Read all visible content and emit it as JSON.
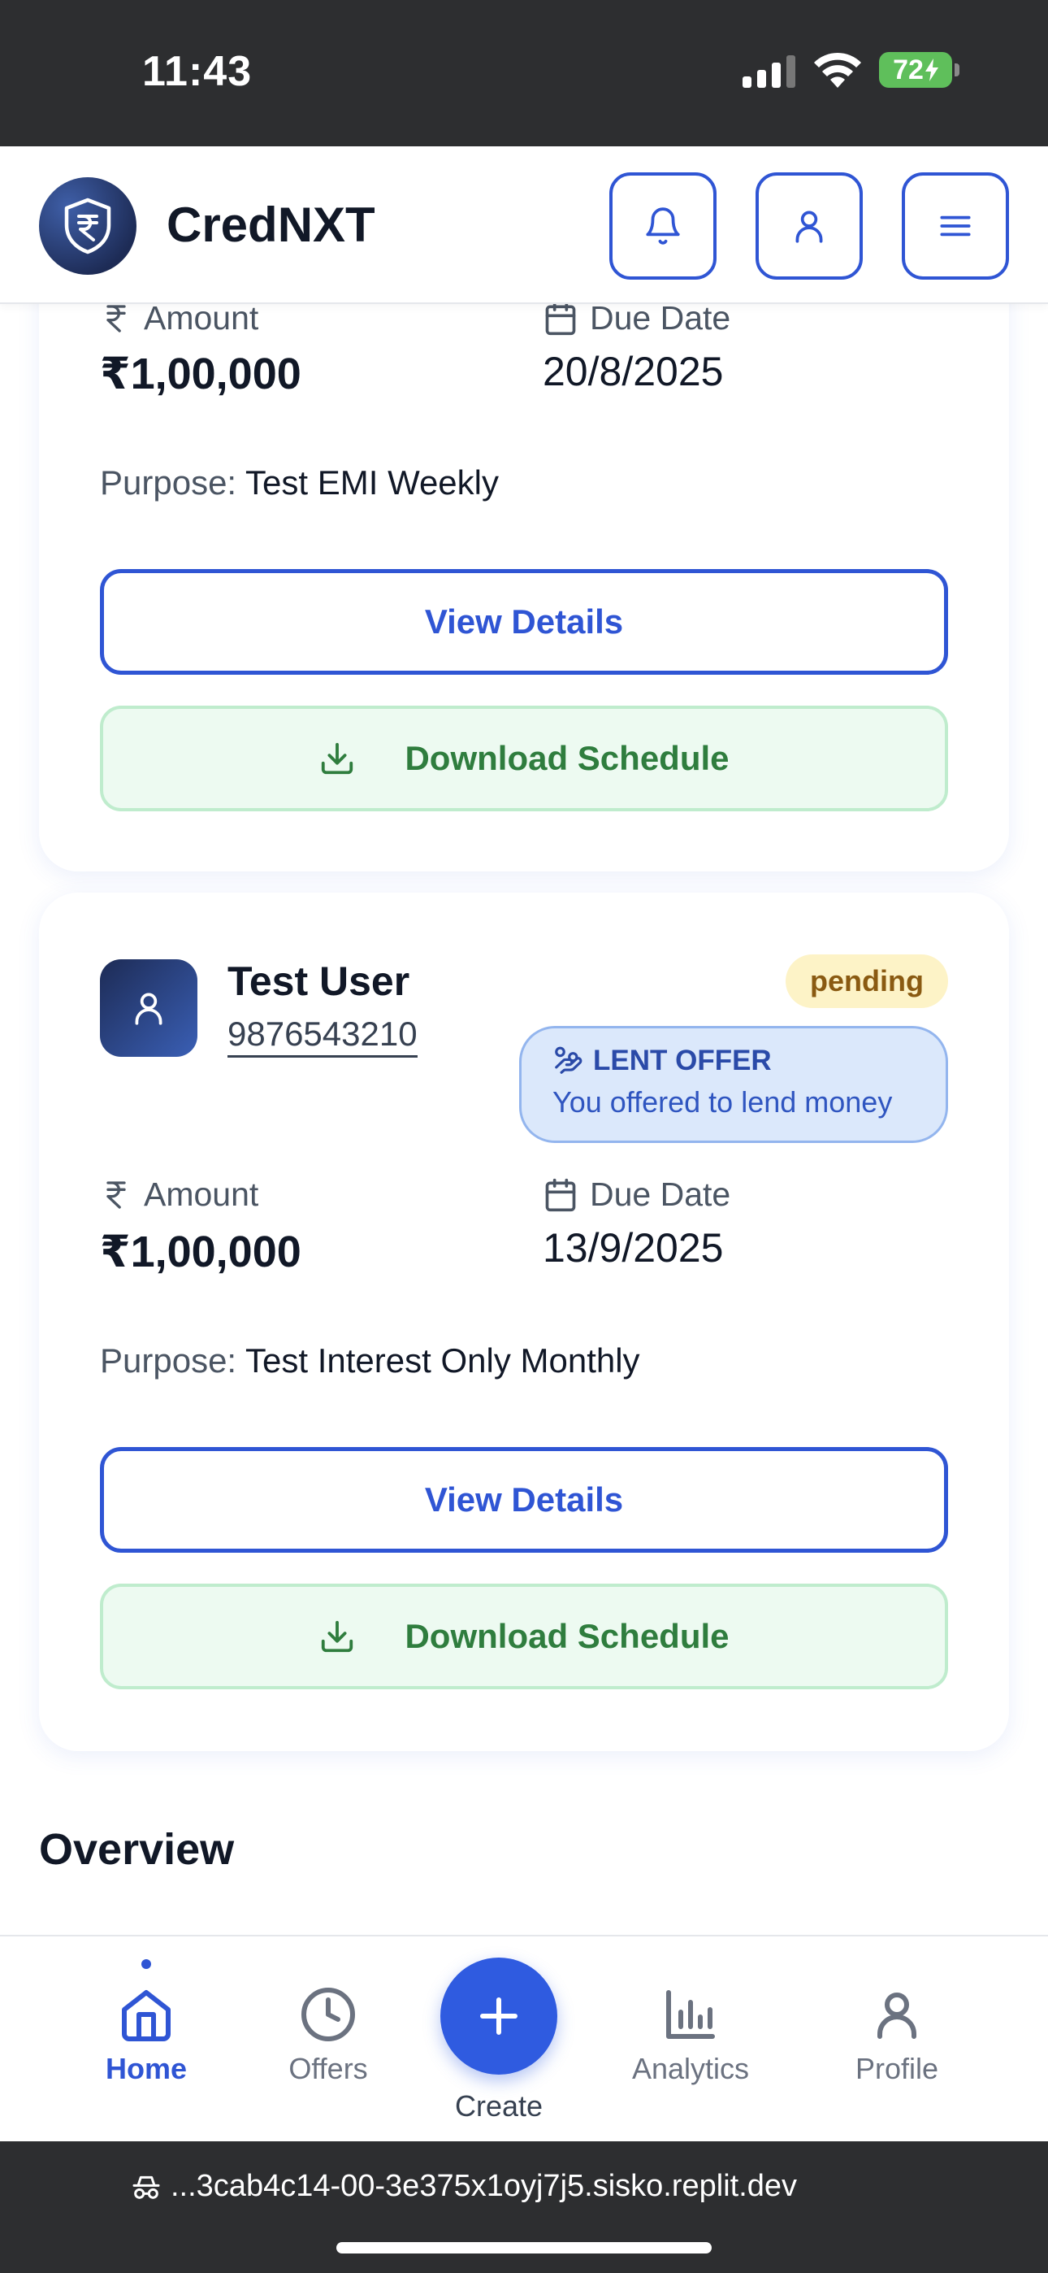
{
  "status_bar": {
    "time": "11:43",
    "battery": "72"
  },
  "header": {
    "brand": "CredNXT",
    "icons": [
      "shield-rupee-icon",
      "bell-icon",
      "user-icon",
      "menu-icon"
    ]
  },
  "cards": [
    {
      "amount_label": "Amount",
      "amount": "₹1,00,000",
      "due_label": "Due Date",
      "due_date": "20/8/2025",
      "purpose_label": "Purpose:",
      "purpose": "Test EMI Weekly",
      "view_label": "View Details",
      "download_label": "Download Schedule"
    },
    {
      "user_name": "Test User",
      "phone": "9876543210",
      "status": "pending",
      "offer_type": "LENT OFFER",
      "offer_desc": "You offered to lend money",
      "amount_label": "Amount",
      "amount": "₹1,00,000",
      "due_label": "Due Date",
      "due_date": "13/9/2025",
      "purpose_label": "Purpose:",
      "purpose": "Test Interest Only Monthly",
      "view_label": "View Details",
      "download_label": "Download Schedule"
    }
  ],
  "section_title": "Overview",
  "bottom_nav": {
    "items": [
      {
        "label": "Home",
        "icon": "home-icon",
        "active": true
      },
      {
        "label": "Offers",
        "icon": "clock-icon",
        "active": false
      },
      {
        "label": "Create",
        "icon": "plus-icon",
        "active": false
      },
      {
        "label": "Analytics",
        "icon": "bar-chart-icon",
        "active": false
      },
      {
        "label": "Profile",
        "icon": "user-icon",
        "active": false
      }
    ]
  },
  "browser": {
    "url": "...3cab4c14-00-3e375x1oyj7j5.sisko.replit.dev"
  },
  "colors": {
    "primary": "#2f55d4",
    "success": "#2f7d3e",
    "pending_bg": "#fdf3c7",
    "offer_bg": "#dbe8fb"
  }
}
